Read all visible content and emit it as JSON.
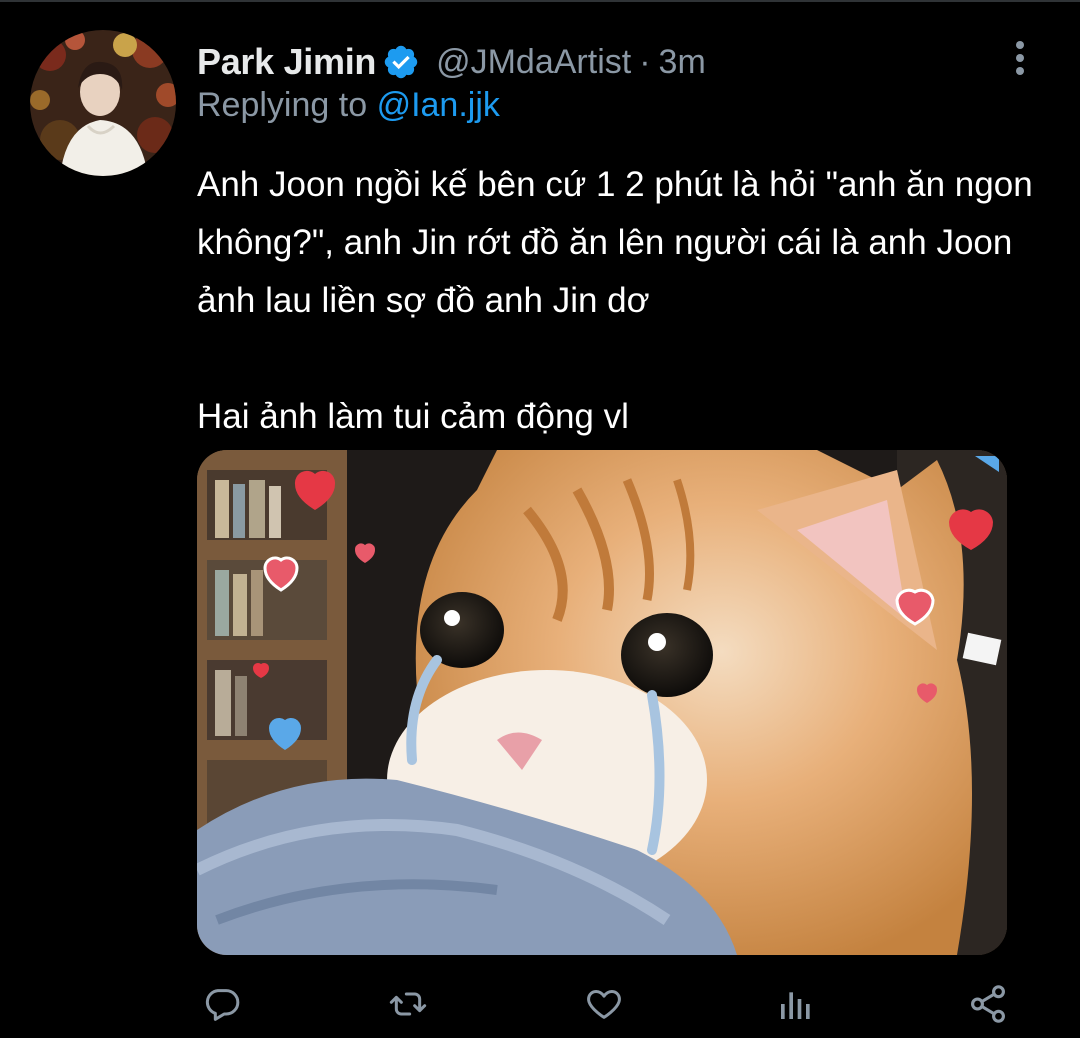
{
  "tweet": {
    "display_name": "Park Jimin",
    "handle": "@JMdaArtist",
    "separator": "·",
    "time": "3m",
    "replying_prefix": "Replying to",
    "replying_to": "@Ian.jjk",
    "paragraphs": [
      "Anh Joon ngồi kế bên cứ 1 2 phút là hỏi \"anh ăn ngon không?\", anh Jin rớt đồ ăn lên người cái là anh Joon ảnh lau liền sợ đồ anh Jin dơ",
      "Hai ảnh làm tui cảm động vl"
    ]
  },
  "icons": {
    "verified": "verified-badge-icon",
    "more": "more-vertical-icon",
    "reply": "reply-icon",
    "retweet": "retweet-icon",
    "like": "heart-icon",
    "analytics": "analytics-icon",
    "share": "share-icon"
  },
  "colors": {
    "background": "#000000",
    "primary_text": "#e7e9ea",
    "secondary_text": "#8b98a5",
    "accent": "#1d9bf0"
  }
}
